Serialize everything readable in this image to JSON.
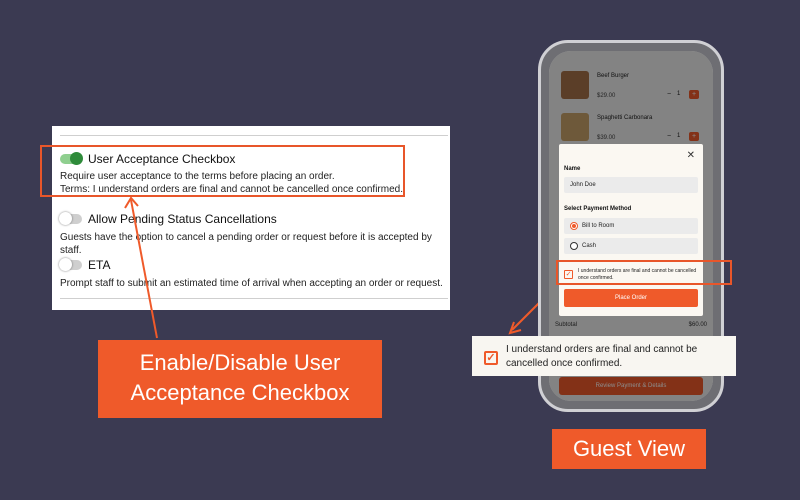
{
  "admin": {
    "settings": [
      {
        "title": "User Acceptance Checkbox",
        "enabled": true,
        "description_lines": [
          "Require user acceptance to the terms before placing an order.",
          "Terms: I understand orders are final and cannot be cancelled once confirmed."
        ]
      },
      {
        "title": "Allow Pending Status Cancellations",
        "enabled": false,
        "description_lines": [
          "Guests have the option to cancel a pending order or request before it is accepted by staff."
        ]
      },
      {
        "title": "ETA",
        "enabled": false,
        "description_lines": [
          "Prompt staff to submit an estimated time of arrival when accepting an order or request."
        ]
      }
    ]
  },
  "callouts": {
    "admin_lines": [
      "Enable/Disable User",
      "Acceptance Checkbox"
    ],
    "guest": "Guest View"
  },
  "phone": {
    "cart_items": [
      {
        "name": "Beef Burger",
        "price": "$29.00",
        "qty": "1"
      },
      {
        "name": "Spaghetti Carbonara",
        "price": "$39.00",
        "qty": "1"
      }
    ],
    "subtotal_label": "Subtotal",
    "subtotal_value": "$60.00",
    "review_button": "Review Payment & Details",
    "modal": {
      "name_label": "Name",
      "name_value": "John Doe",
      "payment_label": "Select Payment Method",
      "options": [
        {
          "label": "Bill to Room",
          "selected": true
        },
        {
          "label": "Cash",
          "selected": false
        }
      ],
      "terms_text": "I understand orders are final and cannot be cancelled once confirmed.",
      "place_order": "Place Order"
    }
  },
  "zoom": {
    "lines": [
      "I understand orders are final and cannot be",
      "cancelled once confirmed."
    ]
  },
  "colors": {
    "background": "#3b3a52",
    "accent": "#ef5a2a",
    "toggle_on": "#2e8b3a"
  },
  "icons": [
    "toggle-on-icon",
    "toggle-off-icon",
    "close-icon",
    "checkbox-checked-icon",
    "radio-selected-icon",
    "radio-unselected-icon",
    "arrow-icon"
  ]
}
